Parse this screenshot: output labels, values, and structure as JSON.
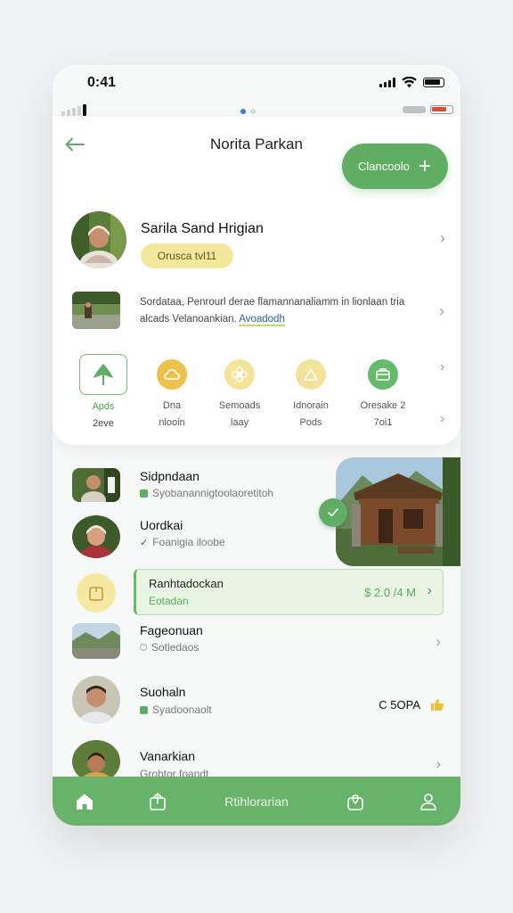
{
  "status": {
    "time": "0:41"
  },
  "header": {
    "title": "Norita Parkan",
    "create_label": "Clancoolo"
  },
  "profile": {
    "name": "Sarila Sand Hrigian",
    "badge": "Orusca tvl11"
  },
  "description": {
    "text": "Sordataa, Penrourl derae flamannanaliamm in lionlaan tria alcads Velanoankian.",
    "link": "Avoadodh"
  },
  "categories": [
    {
      "line1": "Apds",
      "line2": "2eve",
      "icon": "plant-icon",
      "color": "#5fae63"
    },
    {
      "line1": "Dna",
      "line2": "nlooin",
      "icon": "cloud-icon",
      "color": "#edc24a"
    },
    {
      "line1": "Semoads",
      "line2": "laay",
      "icon": "flower-icon",
      "color": "#f4e59a"
    },
    {
      "line1": "Idnorain",
      "line2": "Pods",
      "icon": "triangle-icon",
      "color": "#f3e29a"
    },
    {
      "line1": "Oresake 2",
      "line2": "7oi1",
      "icon": "briefcase-icon",
      "color": "#67b96b"
    }
  ],
  "list": [
    {
      "title": "Sidpndaan",
      "sub": "Syobanannigtoolaoretitoh",
      "sub_color": "#5fae63"
    },
    {
      "title": "Uordkai",
      "sub": "Foanigia iloobe",
      "sub_color": "#5fae63"
    },
    {
      "title": "Fageonuan",
      "sub": "Sotledaos",
      "sub_color": "#aaaaaa"
    },
    {
      "title": "Suohaln",
      "sub": "Syadoonaolt",
      "sub_color": "#5fae63",
      "value": "C 5OPA"
    },
    {
      "title": "Vanarkian",
      "sub": "Grobtor foandt",
      "sub_color": "#5fae63"
    }
  ],
  "highlight": {
    "title": "Ranhtadockan",
    "sub": "Eotadan",
    "price": "$ 2.0 /4 M"
  },
  "tabbar": {
    "center_label": "Rtihlorarian"
  },
  "colors": {
    "accent": "#5fae63",
    "badge": "#f3e79b"
  }
}
